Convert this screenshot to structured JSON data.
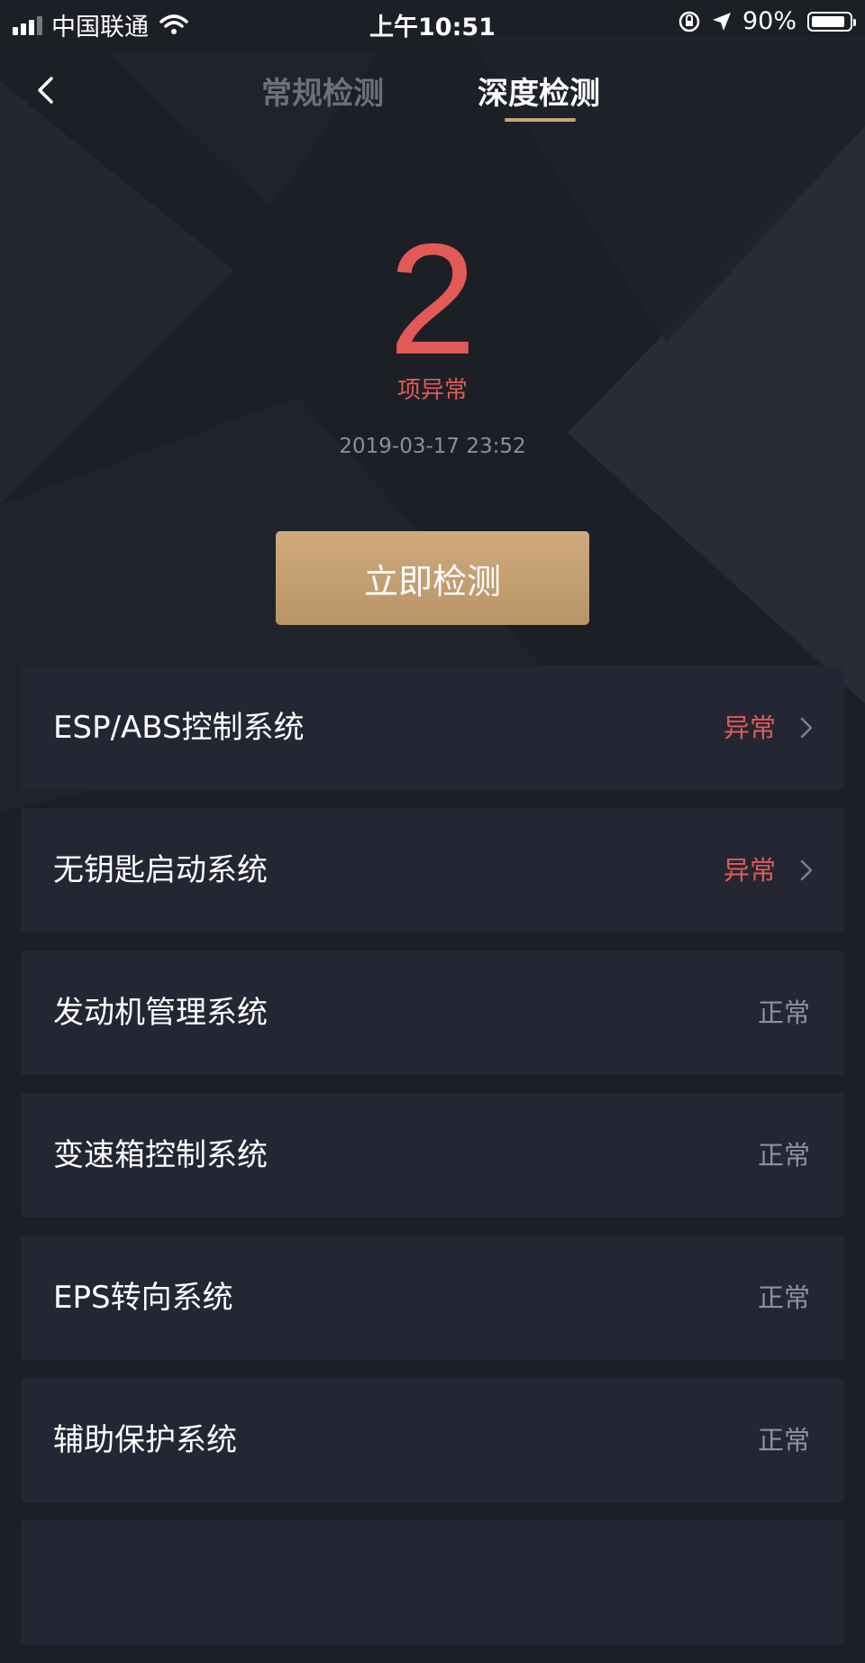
{
  "status_bar": {
    "carrier": "中国联通",
    "time": "上午10:51",
    "battery": "90%",
    "battery_level": 0.9
  },
  "nav": {
    "tabs": [
      {
        "label": "常规检测",
        "active": false
      },
      {
        "label": "深度检测",
        "active": true
      }
    ]
  },
  "summary": {
    "count": "2",
    "count_label": "项异常",
    "timestamp": "2019-03-17 23:52"
  },
  "detect_button": {
    "label": "立即检测"
  },
  "items": [
    {
      "label": "ESP/ABS控制系统",
      "status": "异常",
      "abnormal": true
    },
    {
      "label": "无钥匙启动系统",
      "status": "异常",
      "abnormal": true
    },
    {
      "label": "发动机管理系统",
      "status": "正常",
      "abnormal": false
    },
    {
      "label": "变速箱控制系统",
      "status": "正常",
      "abnormal": false
    },
    {
      "label": "EPS转向系统",
      "status": "正常",
      "abnormal": false
    },
    {
      "label": "辅助保护系统",
      "status": "正常",
      "abnormal": false
    }
  ],
  "colors": {
    "background": "#1d1f27",
    "card": "#242733",
    "accent_gold": "#c9a477",
    "abnormal_red": "#e15a56",
    "normal_gray": "#8f929e"
  }
}
